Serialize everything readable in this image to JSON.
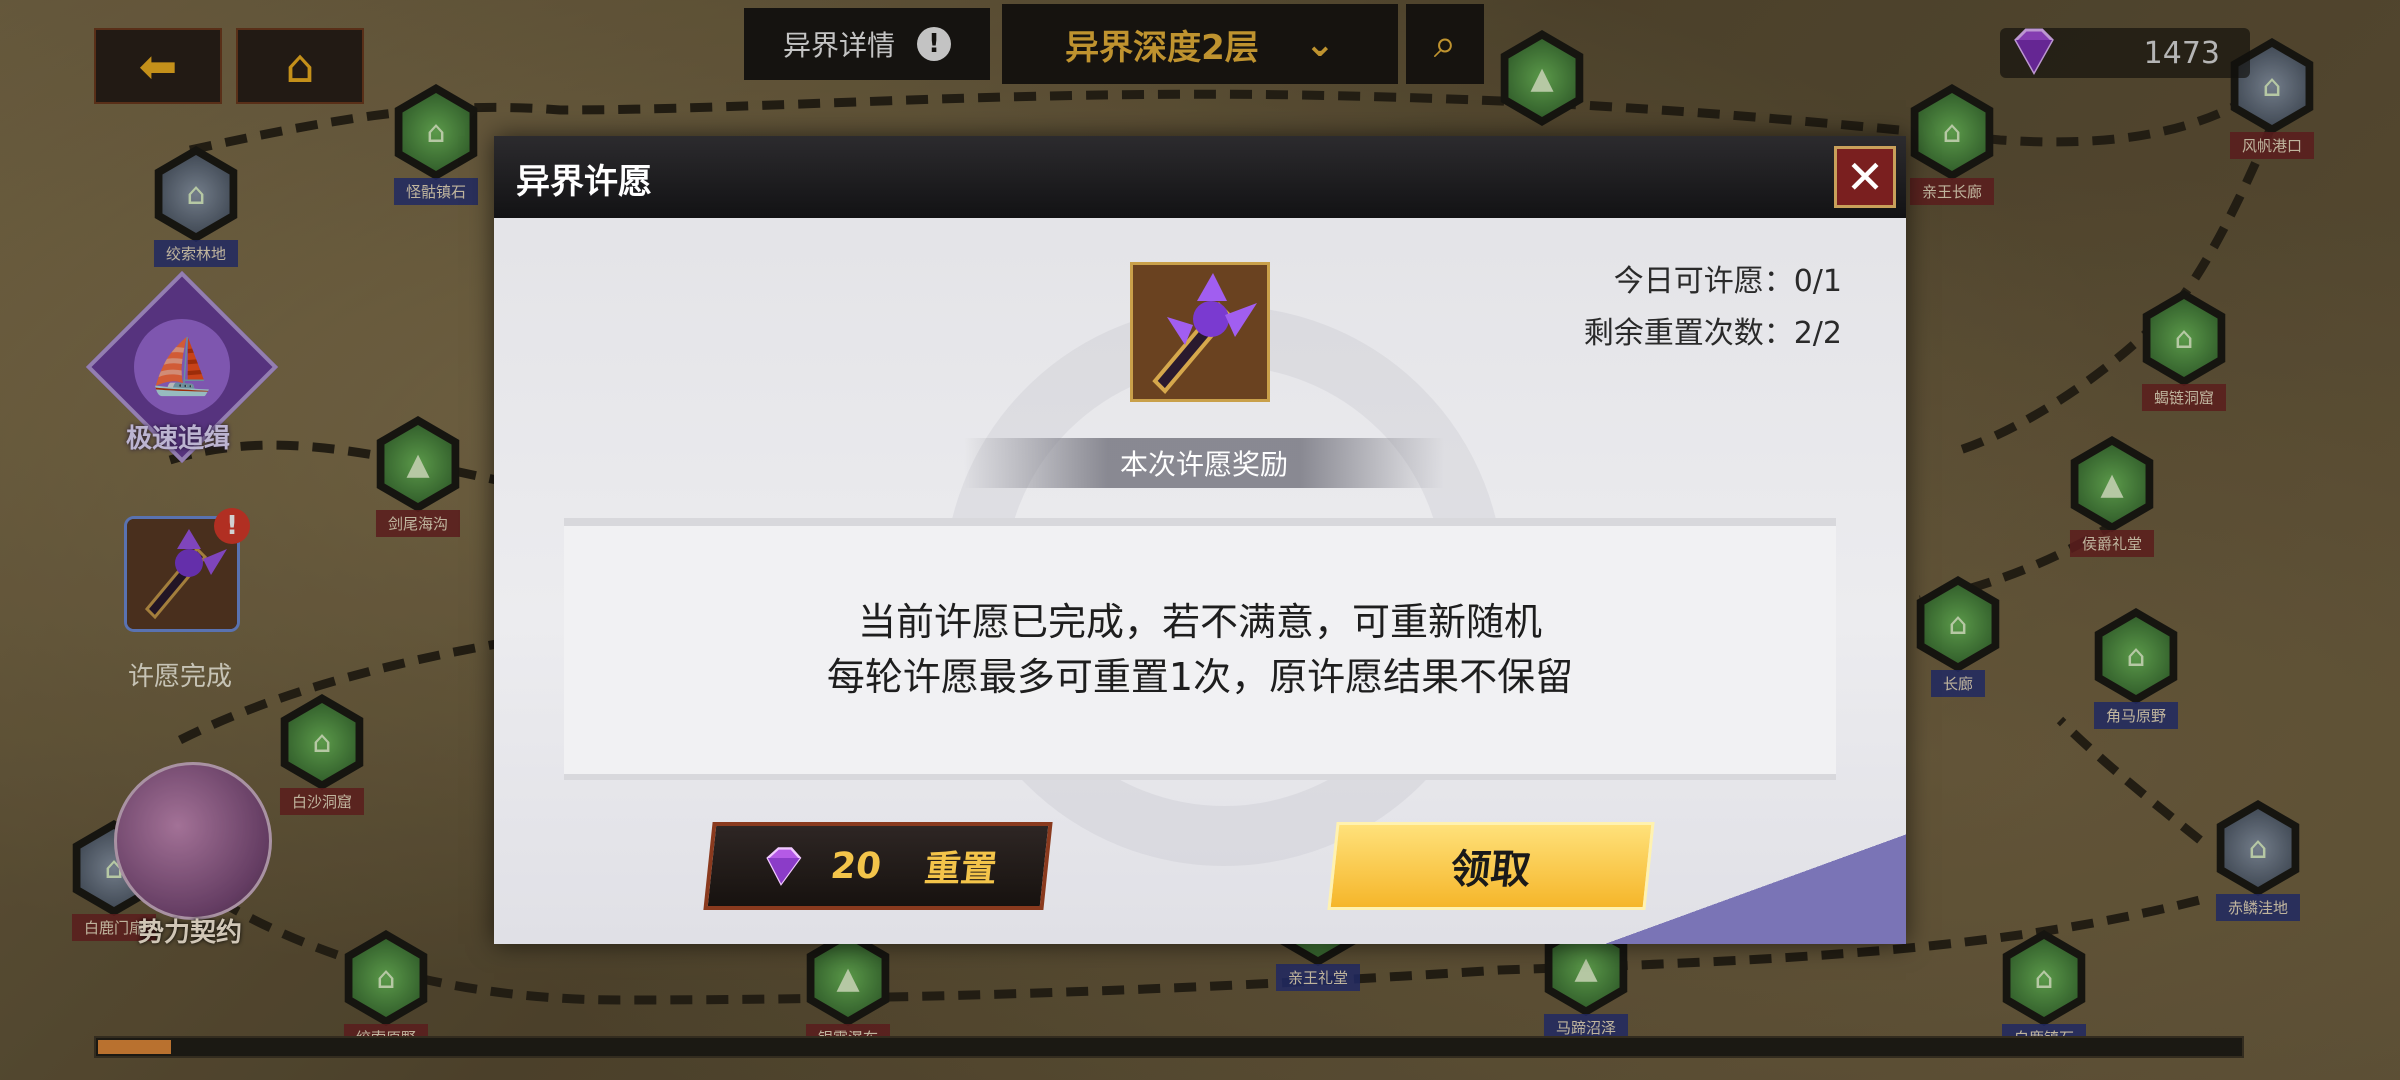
{
  "top_bar": {
    "back_icon": "back-arrow-icon",
    "home_icon": "home-icon",
    "detail_tab": "异界详情",
    "detail_info_icon": "!",
    "depth_tab": "异界深度2层",
    "depth_chevron": "⌄",
    "search_icon": "⌕",
    "gem_count": "1473"
  },
  "left_panel": {
    "quick_chase_label": "极速追缉",
    "wish_badge": "!",
    "wish_done_label": "许愿完成",
    "faction_contract_label": "势力契约"
  },
  "map_nodes": [
    {
      "name": "怪骷镇石",
      "variant": "green",
      "label_color": "blue"
    },
    {
      "name": "绞索林地",
      "variant": "gray",
      "label_color": "blue"
    },
    {
      "name": "剑尾海沟",
      "variant": "green",
      "label_color": "red"
    },
    {
      "name": "白沙洞窟",
      "variant": "green",
      "label_color": "red"
    },
    {
      "name": "白鹿门扉",
      "variant": "gray",
      "label_color": "red"
    },
    {
      "name": "绞索原野",
      "variant": "green",
      "label_color": "red"
    },
    {
      "name": "银雾瀑布",
      "variant": "green",
      "label_color": "red"
    },
    {
      "name": "亲王礼堂",
      "variant": "green",
      "label_color": "blue"
    },
    {
      "name": "马蹄沼泽",
      "variant": "green",
      "label_color": "blue"
    },
    {
      "name": "白鹿镇石",
      "variant": "green",
      "label_color": "blue"
    },
    {
      "name": "亲王长廊",
      "variant": "green",
      "label_color": "red"
    },
    {
      "name": "风帆港口",
      "variant": "gray",
      "label_color": "red"
    },
    {
      "name": "蝎链洞窟",
      "variant": "green",
      "label_color": "red"
    },
    {
      "name": "侯爵礼堂",
      "variant": "green",
      "label_color": "red"
    },
    {
      "name": "长廊",
      "variant": "green",
      "label_color": "blue"
    },
    {
      "name": "角马原野",
      "variant": "green",
      "label_color": "blue"
    },
    {
      "name": "赤鳞洼地",
      "variant": "gray",
      "label_color": "blue"
    }
  ],
  "dialog": {
    "title": "异界许愿",
    "close_glyph": "✕",
    "today_wishes": "今日可许愿：0/1",
    "reset_remaining": "剩余重置次数：2/2",
    "reward_banner": "本次许愿奖励",
    "message_line1": "当前许愿已完成，若不满意，可重新随机",
    "message_line2": "每轮许愿最多可重置1次，原许愿结果不保留",
    "reset_cost": "20",
    "reset_label": "重置",
    "claim_label": "领取"
  },
  "progress": {
    "fraction": 0.034
  },
  "colors": {
    "accent_gold": "#e9b43a",
    "gem_purple": "#a24bd8",
    "close_red": "#7a1f1f",
    "claim_yellow": "#f5b62a"
  }
}
